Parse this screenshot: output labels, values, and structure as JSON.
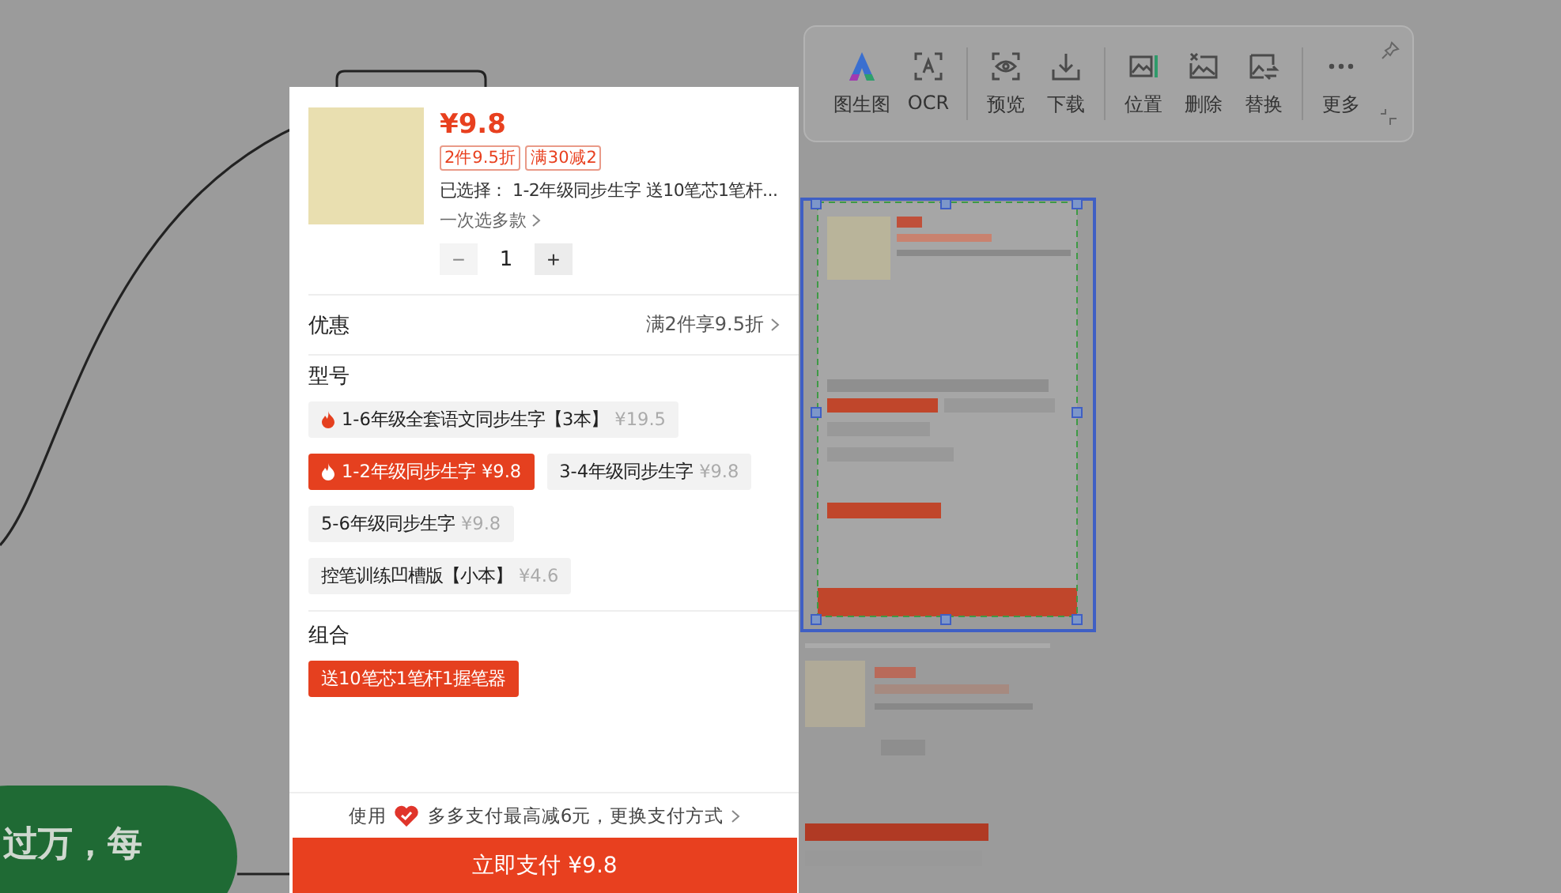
{
  "toolbar": {
    "groups": [
      [
        {
          "label": "图生图"
        },
        {
          "label": "OCR"
        }
      ],
      [
        {
          "label": "预览"
        },
        {
          "label": "下载"
        }
      ],
      [
        {
          "label": "位置"
        },
        {
          "label": "删除"
        },
        {
          "label": "替换"
        }
      ],
      [
        {
          "label": "更多"
        }
      ]
    ]
  },
  "product": {
    "price": "¥9.8",
    "tags": [
      "2件9.5折",
      "满30减2"
    ],
    "selected_text": "已选择：  1-2年级同步生字 送10笔芯1笔杆...",
    "multi": "一次选多款",
    "minus": "−",
    "quantity": "1",
    "plus": "+",
    "minus_disabled": true
  },
  "discount": {
    "label": "优惠",
    "value": "满2件享9.5折"
  },
  "sections": [
    {
      "title": "型号",
      "options": [
        {
          "name": "1-6年级全套语文同步生字【3本】",
          "price": "¥19.5",
          "hot": true,
          "selected": false
        },
        {
          "name": "1-2年级同步生字",
          "price": "¥9.8",
          "hot": true,
          "selected": true
        },
        {
          "name": "3-4年级同步生字",
          "price": "¥9.8",
          "hot": false,
          "selected": false
        },
        {
          "name": "5-6年级同步生字",
          "price": "¥9.8",
          "hot": false,
          "selected": false
        },
        {
          "name": "控笔训练凹槽版【小本】",
          "price": "¥4.6",
          "hot": false,
          "selected": false
        }
      ]
    },
    {
      "title": "组合",
      "options": [
        {
          "name": "送10笔芯1笔杆1握笔器",
          "hot": false,
          "selected": true
        }
      ]
    }
  ],
  "pay_hint": {
    "prefix": "使用",
    "text": "多多支付最高减6元，更换支付方式"
  },
  "pay_button": "立即支付 ¥9.8",
  "bubble_text": "过万，每"
}
